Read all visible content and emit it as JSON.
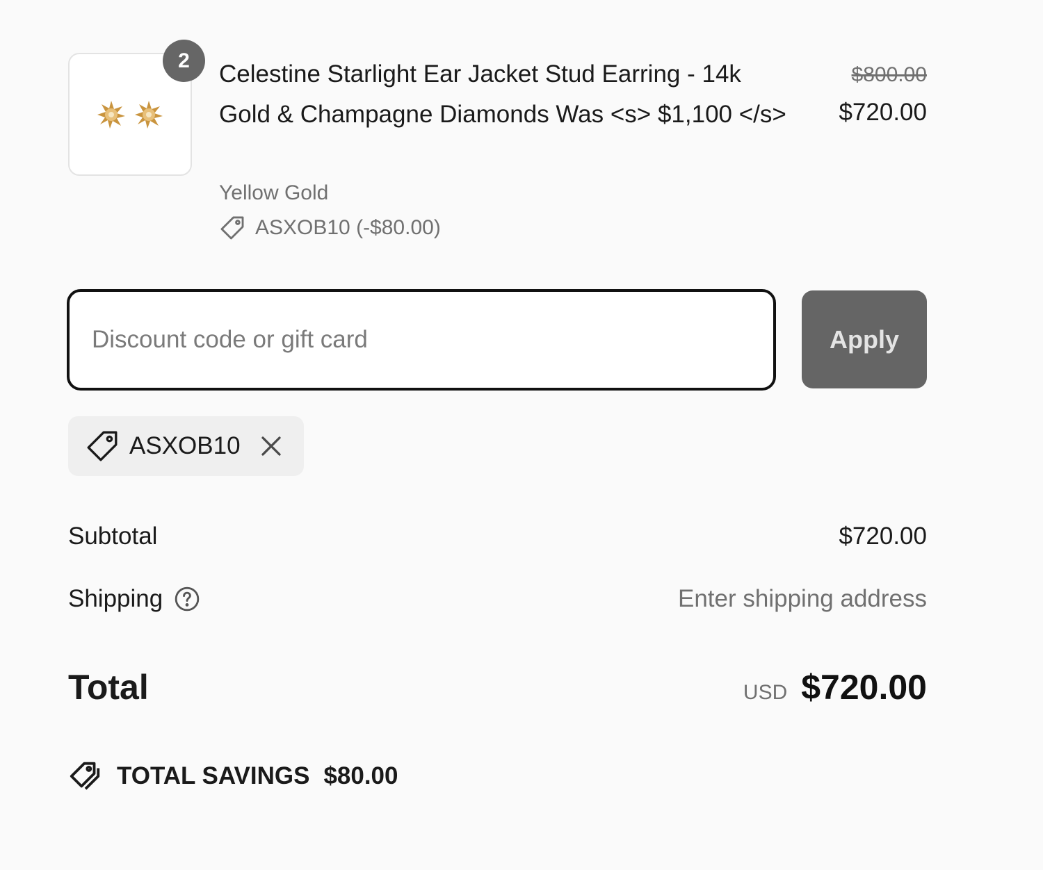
{
  "line_item": {
    "quantity": "2",
    "image_icon": "earring-studs-image",
    "name": "Celestine Starlight Ear Jacket Stud Earring - 14k Gold & Champagne Diamonds Was <s> $1,100 </s>",
    "variant": "Yellow Gold",
    "discount_icon": "tag-icon",
    "discount_label": "ASXOB10 (-$80.00)",
    "compare_at_price": "$800.00",
    "price": "$720.00"
  },
  "discount_form": {
    "placeholder": "Discount code or gift card",
    "value": "",
    "apply_label": "Apply"
  },
  "applied_code": {
    "icon": "tag-icon",
    "code": "ASXOB10",
    "remove_icon": "close-icon"
  },
  "summary": {
    "subtotal_label": "Subtotal",
    "subtotal_value": "$720.00",
    "shipping_label": "Shipping",
    "shipping_help_icon": "question-circle-icon",
    "shipping_value": "Enter shipping address",
    "total_label": "Total",
    "currency": "USD",
    "total_value": "$720.00"
  },
  "savings": {
    "icon": "tags-icon",
    "label": "TOTAL SAVINGS",
    "amount": "$80.00"
  },
  "colors": {
    "background": "#fafafa",
    "text": "#1a1a1a",
    "muted_text": "#707070",
    "badge": "#666666",
    "apply_button": "#656565",
    "chip_background": "#efefef",
    "earring_gold": "#c9943e"
  }
}
